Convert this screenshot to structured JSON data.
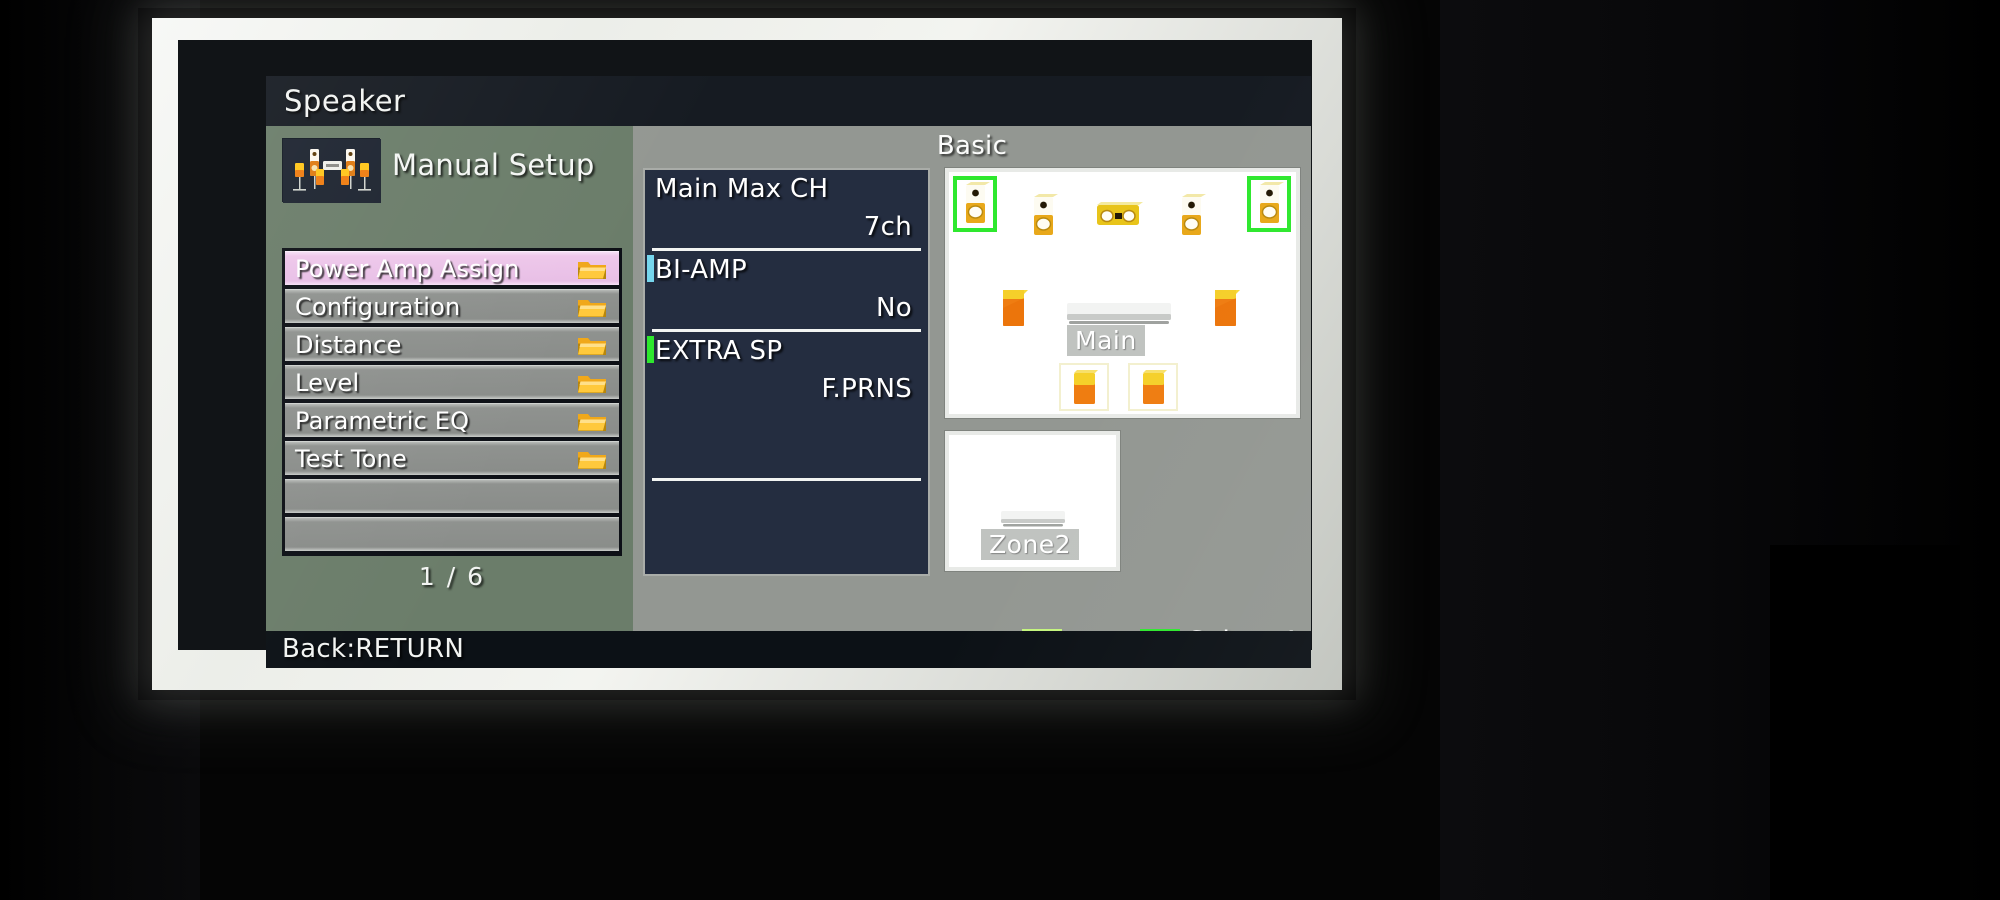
{
  "screen": {
    "title": "Speaker",
    "footer_hint": "Back:RETURN"
  },
  "left_panel": {
    "setup_label": "Manual Setup",
    "setup_icon": "speaker-setup-icon",
    "page_counter": "1 / 6",
    "menu_items": [
      {
        "label": "Power Amp Assign",
        "selected": true,
        "icon": "folder-icon"
      },
      {
        "label": "Configuration",
        "selected": false,
        "icon": "folder-icon"
      },
      {
        "label": "Distance",
        "selected": false,
        "icon": "folder-icon"
      },
      {
        "label": "Level",
        "selected": false,
        "icon": "folder-icon"
      },
      {
        "label": "Parametric EQ",
        "selected": false,
        "icon": "folder-icon"
      },
      {
        "label": "Test Tone",
        "selected": false,
        "icon": "folder-icon"
      },
      {
        "label": "",
        "selected": false,
        "icon": ""
      },
      {
        "label": "",
        "selected": false,
        "icon": ""
      }
    ]
  },
  "right_panel": {
    "section_title": "Basic",
    "settings": [
      {
        "name": "Main Max CH",
        "value": "7ch",
        "marker_color": ""
      },
      {
        "name": "BI-AMP",
        "value": "No",
        "marker_color": "#76d6ee"
      },
      {
        "name": "EXTRA SP",
        "value": "F.PRNS",
        "marker_color": "#2ee82e"
      }
    ],
    "rooms": [
      {
        "name": "Main",
        "label": "Main"
      },
      {
        "name": "Zone2",
        "label": "Zone2"
      }
    ],
    "legend": {
      "text": "Select Automatically",
      "arrow_icon": "double-arrow-icon",
      "swatch_left_color": "#b9f06a",
      "swatch_right_color": "#2ee82e"
    }
  },
  "colors": {
    "accent_green": "#2ee82e",
    "selected_row": "#e8bfe6",
    "panel_navy": "#242d40",
    "sidebar_green": "#6b7d6a",
    "speaker_yellow": "#ffd11a",
    "speaker_orange": "#ef7d11"
  }
}
